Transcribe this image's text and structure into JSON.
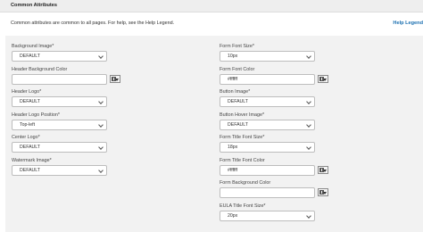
{
  "section": {
    "title": "Common Attributes"
  },
  "intro": "Common attributes are common to all pages. For help, see the Help Legend.",
  "help_link": "Help Legend",
  "left_fields": [
    {
      "label": "Background Image*",
      "type": "select",
      "value": "DEFAULT"
    },
    {
      "label": "Header Background Color",
      "type": "color",
      "value": ""
    },
    {
      "label": "Header Logo*",
      "type": "select",
      "value": "DEFAULT"
    },
    {
      "label": "Header Logo Position*",
      "type": "select",
      "value": "Top-left"
    },
    {
      "label": "Center Logo*",
      "type": "select",
      "value": "DEFAULT"
    },
    {
      "label": "Watermark Image*",
      "type": "select",
      "value": "DEFAULT"
    }
  ],
  "right_fields": [
    {
      "label": "Form Font Size*",
      "type": "select",
      "value": "10px"
    },
    {
      "label": "Form Font Color",
      "type": "color",
      "value": "#ffffff"
    },
    {
      "label": "Button Image*",
      "type": "select",
      "value": "DEFAULT"
    },
    {
      "label": "Button Hover Image*",
      "type": "select",
      "value": "DEFAULT"
    },
    {
      "label": "Form Title Font Size*",
      "type": "select",
      "value": "18px"
    },
    {
      "label": "Form Title Font Color",
      "type": "color",
      "value": "#ffffff"
    },
    {
      "label": "Form Background Color",
      "type": "color",
      "value": ""
    },
    {
      "label": "EULA Title Font Size*",
      "type": "select",
      "value": "20px"
    }
  ],
  "icons": {
    "dropdown": "chevron-down-icon",
    "color_picker": "color-picker-icon"
  }
}
